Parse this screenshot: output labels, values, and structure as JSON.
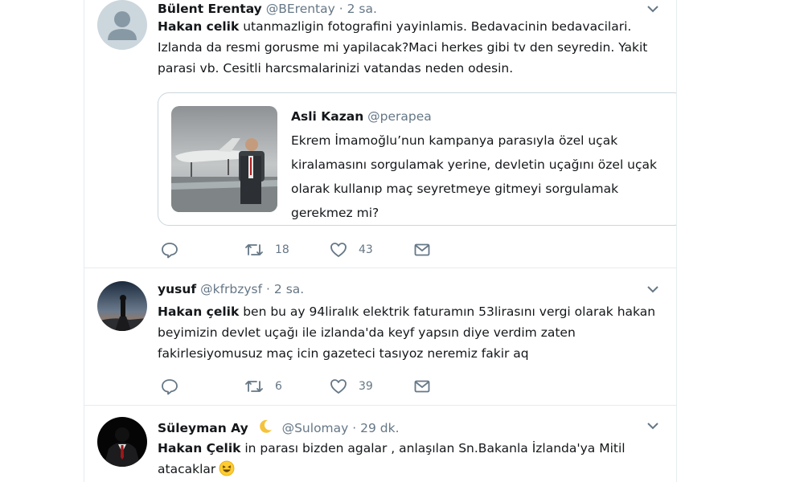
{
  "colors": {
    "text": "#14171a",
    "secondary": "#657786",
    "border": "#e6ecf0",
    "quote_border": "#ccd6dd"
  },
  "tweets": [
    {
      "name": "Bülent Erentay",
      "handle": "@BErentay",
      "separator": "·",
      "time": "2 sa.",
      "mention": "Hakan celik",
      "lines": [
        " utanmazligin fotografini  yayinlamis. Bedavacinin bedavacilari.",
        "Izlanda da resmi gorusme mi yapilacak?Maci herkes gibi  tv den seyredin. Yakit",
        "parasi vb. Cesitli   harcsmalarinizi vatandas neden odesin."
      ],
      "quote": {
        "name": "Asli Kazan",
        "handle": "@perapea",
        "lines": [
          "Ekrem İmamoğlu’nun kampanya parasıyla özel uçak",
          "kiralamasını sorgulamak yerine, devletin uçağını özel uçak",
          "olarak kullanıp maç seyretmeye gitmeyi sorgulamak",
          "gerekmez mi?"
        ]
      },
      "retweets": "18",
      "likes": "43"
    },
    {
      "name": "yusuf",
      "handle": "@kfrbzysf",
      "separator": "·",
      "time": "2 sa.",
      "mention": "Hakan çelik",
      "lines": [
        " ben bu ay 94liralık elektrik faturamın 53lirasını vergi olarak hakan",
        "beyimizin devlet uçağı ile izlanda'da keyf yapsın diye verdim zaten",
        "fakirlesiyomusuz maç icin gazeteci tasıyoz neremiz fakir aq"
      ],
      "retweets": "6",
      "likes": "39"
    },
    {
      "name": "Süleyman Ay",
      "handle": "@Sulomay",
      "separator": "·",
      "time": "29 dk.",
      "mention": "Hakan Çelik",
      "lines": [
        " in parası bizden agalar , anlaşılan Sn.Bakanla İzlanda'ya Mitil",
        "atacaklar"
      ]
    }
  ]
}
